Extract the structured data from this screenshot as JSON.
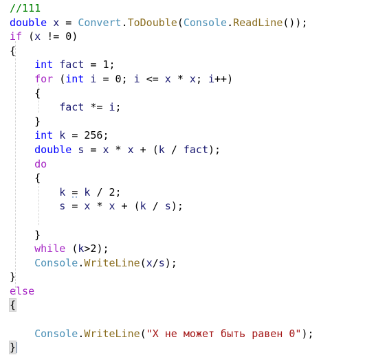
{
  "editor": {
    "language": "C#",
    "background": "#FFFFFF",
    "font_size_px": 15,
    "line_height_px": 20.6,
    "colors": {
      "comment": "#008000",
      "keyword_type": "#0000FF",
      "keyword_control": "#A626C4",
      "class_name": "#4A8FB5",
      "method_name": "#8A6D1F",
      "string": "#A31515",
      "identifier": "#191970",
      "plain": "#000000",
      "indent_guide": "#D4D4D4",
      "brace_match_highlight": "#E2E2E2",
      "caret": "#6E86A8"
    },
    "indent_guides_x": [
      22,
      56,
      90
    ],
    "caret_line_index": 24
  },
  "code": {
    "lines": [
      {
        "i": 0,
        "text": "//111"
      },
      {
        "i": 1,
        "text": "double x = Convert.ToDouble(Console.ReadLine());"
      },
      {
        "i": 2,
        "text": "if (x != 0)"
      },
      {
        "i": 3,
        "text": "{"
      },
      {
        "i": 4,
        "text": "    int fact = 1;"
      },
      {
        "i": 5,
        "text": "    for (int i = 0; i <= x * x; i++)"
      },
      {
        "i": 6,
        "text": "    {"
      },
      {
        "i": 7,
        "text": "        fact *= i;"
      },
      {
        "i": 8,
        "text": "    }"
      },
      {
        "i": 9,
        "text": "    int k = 256;"
      },
      {
        "i": 10,
        "text": "    double s = x * x + (k / fact);"
      },
      {
        "i": 11,
        "text": "    do"
      },
      {
        "i": 12,
        "text": "    {"
      },
      {
        "i": 13,
        "text": "        k = k / 2;"
      },
      {
        "i": 14,
        "text": "        s = x * x + (k / s);"
      },
      {
        "i": 15,
        "text": ""
      },
      {
        "i": 16,
        "text": "    }"
      },
      {
        "i": 17,
        "text": "    while (k>2);"
      },
      {
        "i": 18,
        "text": "    Console.WriteLine(x/s);"
      },
      {
        "i": 19,
        "text": "}"
      },
      {
        "i": 20,
        "text": "else"
      },
      {
        "i": 21,
        "text": "{"
      },
      {
        "i": 22,
        "text": ""
      },
      {
        "i": 23,
        "text": "    Console.WriteLine(\"X не может быть равен 0\");"
      },
      {
        "i": 24,
        "text": "}"
      }
    ],
    "tokens": {
      "comment_111": "//111",
      "kw_double": "double",
      "kw_int": "int",
      "ctl_if": "if",
      "ctl_else": "else",
      "ctl_for": "for",
      "ctl_do": "do",
      "ctl_while": "while",
      "cls_convert": "Convert",
      "cls_console": "Console",
      "mth_todouble": "ToDouble",
      "mth_readline": "ReadLine",
      "mth_writeline": "WriteLine",
      "var_x": "x",
      "var_fact": "fact",
      "var_i": "i",
      "var_k": "k",
      "var_s": "s",
      "num_0": "0",
      "num_1": "1",
      "num_2": "2",
      "num_256": "256",
      "string_error": "\"X не может быть равен 0\"",
      "open_brace": "{",
      "close_brace": "}",
      "semicolon": ";",
      "open_paren": "(",
      "close_paren": ")",
      "dot": ".",
      "assign": "=",
      "not_equal": "!=",
      "less_equal": "<=",
      "greater": ">",
      "increment": "++",
      "mult_assign": "*=",
      "mult": "*",
      "plus": "+",
      "div": "/"
    }
  }
}
